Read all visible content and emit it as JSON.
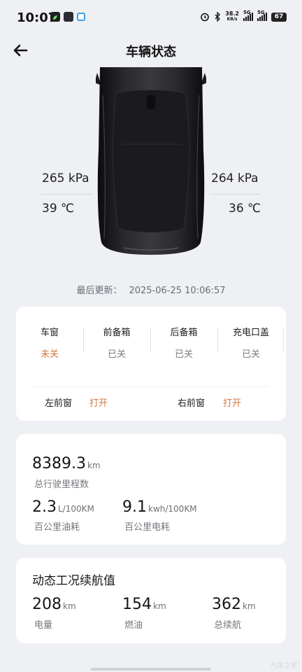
{
  "status_bar": {
    "time": "10:07",
    "net_speed_value": "38.2",
    "net_speed_unit": "KB/s",
    "signal1_label": "5G",
    "signal2_label": "5G",
    "battery": "67",
    "icons": [
      "alarm-icon",
      "bluetooth-icon"
    ]
  },
  "header": {
    "title": "车辆状态",
    "back_icon": "arrow-left-icon"
  },
  "tires": {
    "front_left_pressure": "265 kPa",
    "front_left_temp": "39 ℃",
    "front_right_pressure": "264 kPa",
    "front_right_temp": "36 ℃"
  },
  "last_update": {
    "label": "最后更新：",
    "time": "2025-06-25 10:06:57"
  },
  "status_card": {
    "items": [
      {
        "name": "车窗",
        "state": "未关",
        "alert": true
      },
      {
        "name": "前备箱",
        "state": "已关",
        "alert": false
      },
      {
        "name": "后备箱",
        "state": "已关",
        "alert": false
      },
      {
        "name": "充电口盖",
        "state": "已关",
        "alert": false
      }
    ],
    "windows": [
      {
        "name": "左前窗",
        "state": "打开"
      },
      {
        "name": "右前窗",
        "state": "打开"
      }
    ],
    "alert_color": "#d2783f"
  },
  "mileage_card": {
    "odometer_value": "8389.3",
    "odometer_unit": "km",
    "odometer_label": "总行驶里程数",
    "fuel_value": "2.3",
    "fuel_unit": "L/100KM",
    "fuel_label": "百公里油耗",
    "elec_value": "9.1",
    "elec_unit": "kwh/100KM",
    "elec_label": "百公里电耗"
  },
  "range_card": {
    "title": "动态工况续航值",
    "items": [
      {
        "value": "208",
        "unit": "km",
        "label": "电量"
      },
      {
        "value": "154",
        "unit": "km",
        "label": "燃油"
      },
      {
        "value": "362",
        "unit": "km",
        "label": "总续航"
      }
    ]
  },
  "watermark": "汽车之家"
}
